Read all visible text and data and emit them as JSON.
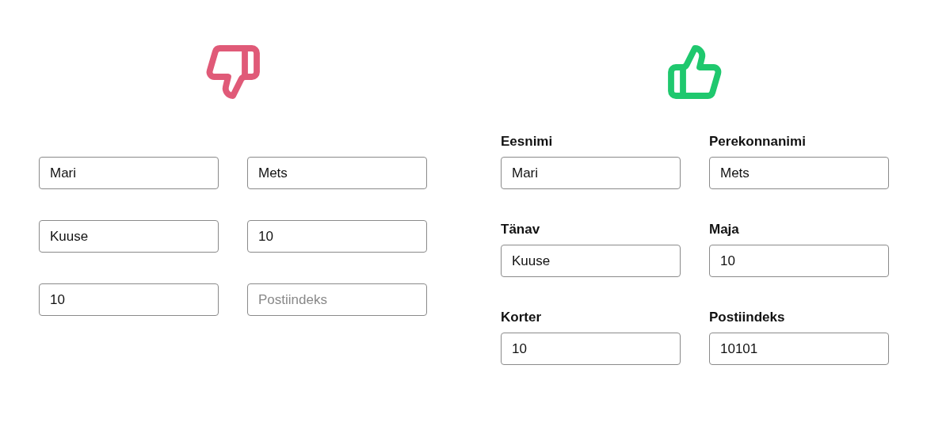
{
  "panels": [
    {
      "kind": "bad",
      "fields": [
        {
          "value": "Mari"
        },
        {
          "value": "Mets"
        },
        {
          "value": "Kuuse"
        },
        {
          "value": "10"
        },
        {
          "value": "10"
        },
        {
          "placeholder": "Postiindeks"
        }
      ]
    },
    {
      "kind": "good",
      "fields": [
        {
          "label": "Eesnimi",
          "value": "Mari"
        },
        {
          "label": "Perekonnanimi",
          "value": "Mets"
        },
        {
          "label": "Tänav",
          "value": "Kuuse"
        },
        {
          "label": "Maja",
          "value": "10"
        },
        {
          "label": "Korter",
          "value": "10"
        },
        {
          "label": "Postiindeks",
          "value": "10101"
        }
      ]
    }
  ]
}
